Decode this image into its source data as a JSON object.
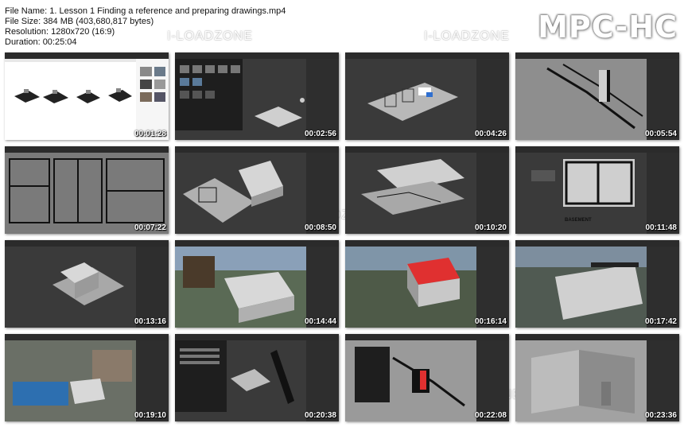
{
  "header": {
    "file_name": "File Name: 1. Lesson 1 Finding a reference and preparing drawings.mp4",
    "file_size": "File Size: 384 MB (403,680,817 bytes)",
    "resolution": "Resolution: 1280x720 (16:9)",
    "duration": "Duration: 00:25:04"
  },
  "logo": "MPC-HC",
  "watermark": "I-LOADZONE",
  "thumbnails": [
    {
      "timestamp": "00:01:28"
    },
    {
      "timestamp": "00:02:56"
    },
    {
      "timestamp": "00:04:26"
    },
    {
      "timestamp": "00:05:54"
    },
    {
      "timestamp": "00:07:22"
    },
    {
      "timestamp": "00:08:50"
    },
    {
      "timestamp": "00:10:20"
    },
    {
      "timestamp": "00:11:48",
      "caption": "BASEMENT"
    },
    {
      "timestamp": "00:13:16"
    },
    {
      "timestamp": "00:14:44"
    },
    {
      "timestamp": "00:16:14"
    },
    {
      "timestamp": "00:17:42"
    },
    {
      "timestamp": "00:19:10"
    },
    {
      "timestamp": "00:20:38"
    },
    {
      "timestamp": "00:22:08"
    },
    {
      "timestamp": "00:23:36"
    }
  ],
  "colors": {
    "viewport": "#3a3a3a",
    "ui_panel": "#2b2b2b",
    "model_gray": "#bdbdbd",
    "accent_red": "#e03030"
  }
}
